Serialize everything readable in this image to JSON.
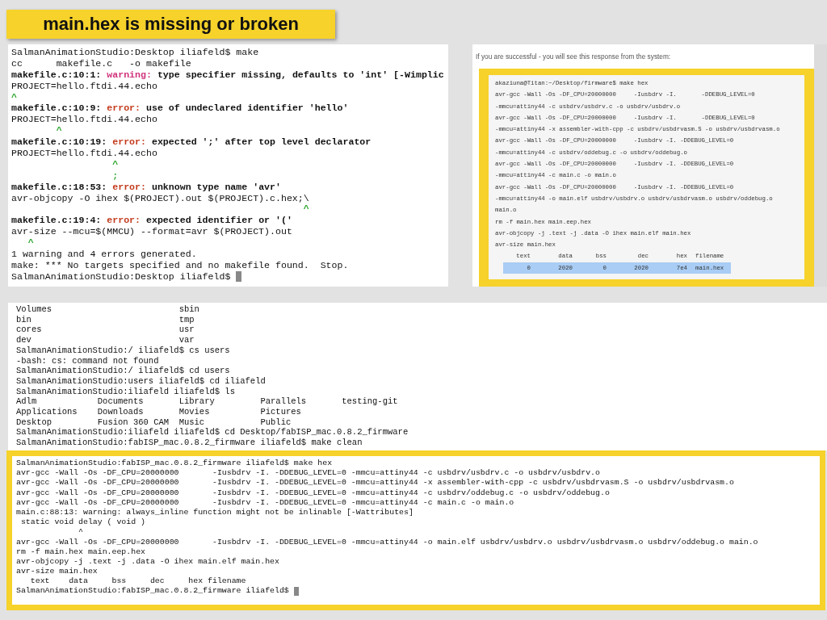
{
  "title": "main.hex is missing or broken",
  "terminal_1": {
    "lines": [
      {
        "parts": [
          {
            "text": "SalmanAnimationStudio:Desktop iliafeld$ make",
            "kind": "plain"
          }
        ]
      },
      {
        "parts": [
          {
            "text": "cc      makefile.c   -o makefile",
            "kind": "plain"
          }
        ]
      },
      {
        "parts": [
          {
            "text": "makefile.c:10:1: ",
            "kind": "bold"
          },
          {
            "text": "warning: ",
            "kind": "warning"
          },
          {
            "text": "type specifier missing, defaults to 'int' [-Wimplic",
            "kind": "bold"
          }
        ]
      },
      {
        "parts": [
          {
            "text": "PROJECT=hello.ftdi.44.echo",
            "kind": "plain"
          }
        ]
      },
      {
        "parts": [
          {
            "text": "^",
            "kind": "caret"
          }
        ]
      },
      {
        "parts": [
          {
            "text": "makefile.c:10:9: ",
            "kind": "bold"
          },
          {
            "text": "error: ",
            "kind": "error"
          },
          {
            "text": "use of undeclared identifier 'hello'",
            "kind": "bold"
          }
        ]
      },
      {
        "parts": [
          {
            "text": "PROJECT=hello.ftdi.44.echo",
            "kind": "plain"
          }
        ]
      },
      {
        "parts": [
          {
            "text": "        ^",
            "kind": "caret"
          }
        ]
      },
      {
        "parts": [
          {
            "text": "makefile.c:10:19: ",
            "kind": "bold"
          },
          {
            "text": "error: ",
            "kind": "error"
          },
          {
            "text": "expected ';' after top level declarator",
            "kind": "bold"
          }
        ]
      },
      {
        "parts": [
          {
            "text": "PROJECT=hello.ftdi.44.echo",
            "kind": "plain"
          }
        ]
      },
      {
        "parts": [
          {
            "text": "                  ^",
            "kind": "caret"
          }
        ]
      },
      {
        "parts": [
          {
            "text": "                  ;",
            "kind": "caret"
          }
        ]
      },
      {
        "parts": [
          {
            "text": "makefile.c:18:53: ",
            "kind": "bold"
          },
          {
            "text": "error: ",
            "kind": "error"
          },
          {
            "text": "unknown type name 'avr'",
            "kind": "bold"
          }
        ]
      },
      {
        "parts": [
          {
            "text": "avr-objcopy -O ihex $(PROJECT).out $(PROJECT).c.hex;\\",
            "kind": "plain"
          }
        ]
      },
      {
        "parts": [
          {
            "text": "                                                    ^",
            "kind": "caret"
          }
        ]
      },
      {
        "parts": [
          {
            "text": "makefile.c:19:4: ",
            "kind": "bold"
          },
          {
            "text": "error: ",
            "kind": "error"
          },
          {
            "text": "expected identifier or '('",
            "kind": "bold"
          }
        ]
      },
      {
        "parts": [
          {
            "text": "avr-size --mcu=$(MMCU) --format=avr $(PROJECT).out",
            "kind": "plain"
          }
        ]
      },
      {
        "parts": [
          {
            "text": "   ^",
            "kind": "caret"
          }
        ]
      },
      {
        "parts": [
          {
            "text": "1 warning and 4 errors generated.",
            "kind": "plain"
          }
        ]
      },
      {
        "parts": [
          {
            "text": "make: *** No targets specified and no makefile found.  Stop.",
            "kind": "plain"
          }
        ]
      }
    ],
    "prompt": "SalmanAnimationStudio:Desktop iliafeld$ "
  },
  "reference": {
    "caption": "If you are successful - you will see this response from the system:",
    "lines": [
      "akaziuna@Titan:~/Desktop/firmware$ make hex",
      "avr-gcc -Wall -Os -DF_CPU=20000000     -Iusbdrv -I.       -DDEBUG_LEVEL=0",
      "-mmcu=attiny44 -c usbdrv/usbdrv.c -o usbdrv/usbdrv.o",
      "avr-gcc -Wall -Os -DF_CPU=20000000     -Iusbdrv -I.       -DDEBUG_LEVEL=0",
      "-mmcu=attiny44 -x assembler-with-cpp -c usbdrv/usbdrvasm.S -o usbdrv/usbdrvasm.o",
      "avr-gcc -Wall -Os -DF_CPU=20000000     -Iusbdrv -I. -DDEBUG_LEVEL=0",
      "-mmcu=attiny44 -c usbdrv/oddebug.c -o usbdrv/oddebug.o",
      "avr-gcc -Wall -Os -DF_CPU=20000000     -Iusbdrv -I. -DDEBUG_LEVEL=0",
      "-mmcu=attiny44 -c main.c -o main.o",
      "avr-gcc -Wall -Os -DF_CPU=20000000     -Iusbdrv -I. -DDEBUG_LEVEL=0",
      "-mmcu=attiny44 -o main.elf usbdrv/usbdrv.o usbdrv/usbdrvasm.o usbdrv/oddebug.o",
      "main.o",
      "rm -f main.hex main.eep.hex",
      "avr-objcopy -j .text -j .data -O ihex main.elf main.hex",
      "avr-size main.hex"
    ],
    "size_table": {
      "columns": [
        "text",
        "data",
        "bss",
        "dec",
        "hex",
        "filename"
      ],
      "rows": [
        {
          "cells": [
            "0",
            "2020",
            "0",
            "2020",
            "7e4",
            "main.hex"
          ],
          "selected": true
        }
      ]
    }
  },
  "terminal_2": {
    "lines": [
      "Volumes                         sbin",
      "bin                             tmp",
      "cores                           usr",
      "dev                             var",
      "SalmanAnimationStudio:/ iliafeld$ cs users",
      "-bash: cs: command not found",
      "SalmanAnimationStudio:/ iliafeld$ cd users",
      "SalmanAnimationStudio:users iliafeld$ cd iliafeld",
      "SalmanAnimationStudio:iliafeld iliafeld$ ls",
      "Adlm            Documents       Library         Parallels       testing-git",
      "Applications    Downloads       Movies          Pictures",
      "Desktop         Fusion 360 CAM  Music           Public",
      "SalmanAnimationStudio:iliafeld iliafeld$ cd Desktop/fabISP_mac.0.8.2_firmware",
      "SalmanAnimationStudio:fabISP_mac.0.8.2_firmware iliafeld$ make clean"
    ]
  },
  "terminal_3": {
    "lines": [
      "SalmanAnimationStudio:fabISP_mac.0.8.2_firmware iliafeld$ make hex",
      "avr-gcc -Wall -Os -DF_CPU=20000000       -Iusbdrv -I. -DDEBUG_LEVEL=0 -mmcu=attiny44 -c usbdrv/usbdrv.c -o usbdrv/usbdrv.o",
      "avr-gcc -Wall -Os -DF_CPU=20000000       -Iusbdrv -I. -DDEBUG_LEVEL=0 -mmcu=attiny44 -x assembler-with-cpp -c usbdrv/usbdrvasm.S -o usbdrv/usbdrvasm.o",
      "avr-gcc -Wall -Os -DF_CPU=20000000       -Iusbdrv -I. -DDEBUG_LEVEL=0 -mmcu=attiny44 -c usbdrv/oddebug.c -o usbdrv/oddebug.o",
      "avr-gcc -Wall -Os -DF_CPU=20000000       -Iusbdrv -I. -DDEBUG_LEVEL=0 -mmcu=attiny44 -c main.c -o main.o",
      "main.c:88:13: warning: always_inline function might not be inlinable [-Wattributes]",
      " static void delay ( void )",
      "             ^",
      "avr-gcc -Wall -Os -DF_CPU=20000000       -Iusbdrv -I. -DDEBUG_LEVEL=0 -mmcu=attiny44 -o main.elf usbdrv/usbdrv.o usbdrv/usbdrvasm.o usbdrv/oddebug.o main.o",
      "rm -f main.hex main.eep.hex",
      "avr-objcopy -j .text -j .data -O ihex main.elf main.hex",
      "avr-size main.hex",
      "   text    data     bss     dec     hex filename"
    ],
    "prompt": "SalmanAnimationStudio:fabISP_mac.0.8.2_firmware iliafeld$ "
  }
}
